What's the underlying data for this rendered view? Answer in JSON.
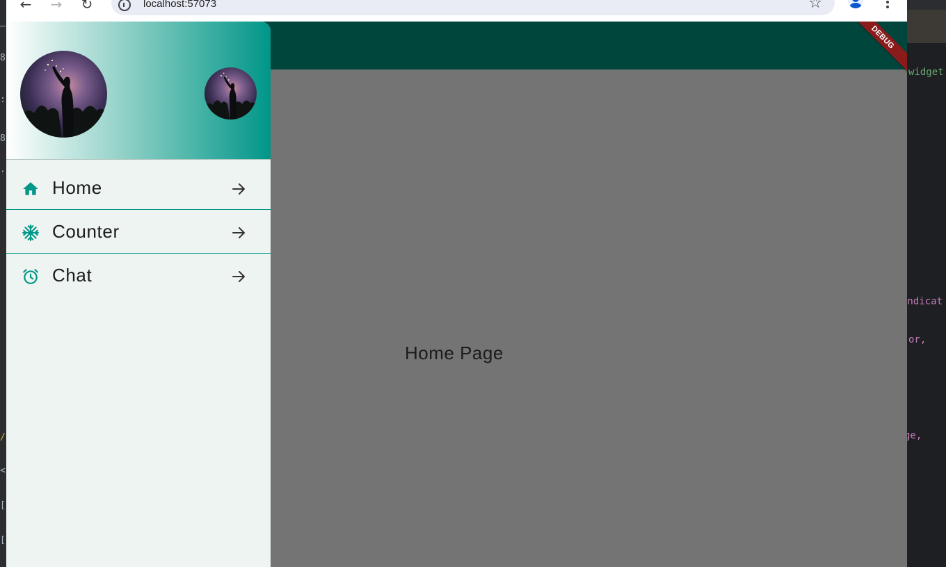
{
  "browser": {
    "url": "localhost:57073",
    "back_icon": "arrow-left",
    "forward_icon": "arrow-right",
    "reload_icon": "refresh",
    "bookmark_icon": "star-outline",
    "menu_icon": "more-vertical"
  },
  "ide": {
    "right_code_lines": [
      {
        "text": "widget",
        "color": "#6aab73"
      },
      {
        "text": "Indicat",
        "color": "#c77dbb"
      },
      {
        "text": "or,",
        "color": "#c77dbb"
      },
      {
        "text": "ge,",
        "color": "#c77dbb"
      }
    ]
  },
  "app": {
    "debug_label": "DEBUG",
    "page_title": "Home Page",
    "app_bar_color": "#00463d",
    "scrim_color": "#737473",
    "accent": "#009688"
  },
  "drawer": {
    "items": [
      {
        "label": "Home",
        "icon": "home-icon"
      },
      {
        "label": "Counter",
        "icon": "snowflake-icon"
      },
      {
        "label": "Chat",
        "icon": "alarm-icon"
      }
    ]
  }
}
